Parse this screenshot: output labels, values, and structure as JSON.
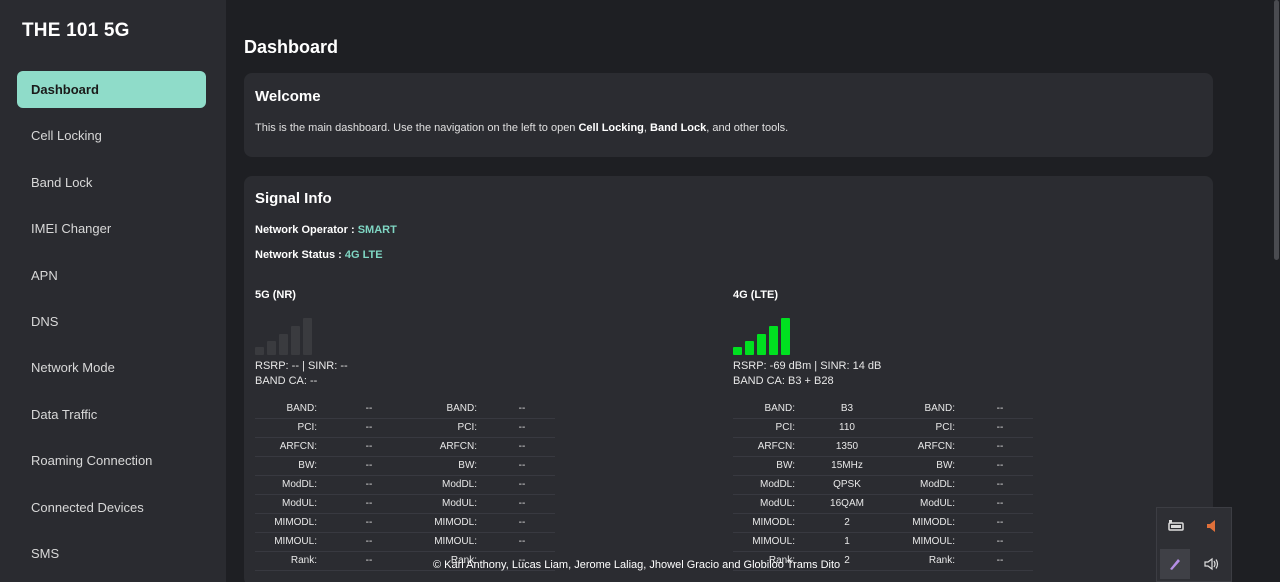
{
  "sidebar": {
    "brand": "THE 101 5G",
    "items": [
      {
        "label": "Dashboard",
        "active": true
      },
      {
        "label": "Cell Locking"
      },
      {
        "label": "Band Lock"
      },
      {
        "label": "IMEI Changer"
      },
      {
        "label": "APN"
      },
      {
        "label": "DNS"
      },
      {
        "label": "Network Mode"
      },
      {
        "label": "Data Traffic"
      },
      {
        "label": "Roaming Connection"
      },
      {
        "label": "Connected Devices"
      },
      {
        "label": "SMS"
      }
    ]
  },
  "main": {
    "title": "Dashboard",
    "welcome": {
      "title": "Welcome",
      "text_before": "This is the main dashboard. Use the navigation on the left to open ",
      "link1": "Cell Locking",
      "sep": ", ",
      "link2": "Band Lock",
      "text_after": ", and other tools."
    },
    "signal": {
      "title": "Signal Info",
      "operator_label": "Network Operator : ",
      "operator_value": "SMART",
      "status_label": "Network Status : ",
      "status_value": "4G LTE",
      "nr": {
        "label": "5G (NR)",
        "bars_active": 0,
        "rsrp_line": "RSRP: -- | SINR: --",
        "bandca_line": "BAND CA: --",
        "table_keys": [
          "BAND:",
          "PCI:",
          "ARFCN:",
          "BW:",
          "ModDL:",
          "ModUL:",
          "MIMODL:",
          "MIMOUL:",
          "Rank:"
        ],
        "col1": [
          "--",
          "--",
          "--",
          "--",
          "--",
          "--",
          "--",
          "--",
          "--"
        ],
        "col2": [
          "--",
          "--",
          "--",
          "--",
          "--",
          "--",
          "--",
          "--",
          "--"
        ]
      },
      "lte": {
        "label": "4G (LTE)",
        "bars_active": 5,
        "rsrp_line": "RSRP: -69 dBm | SINR: 14 dB",
        "bandca_line": "BAND CA: B3 + B28",
        "table_keys": [
          "BAND:",
          "PCI:",
          "ARFCN:",
          "BW:",
          "ModDL:",
          "ModUL:",
          "MIMODL:",
          "MIMOUL:",
          "Rank:"
        ],
        "col1": [
          "B3",
          "110",
          "1350",
          "15MHz",
          "QPSK",
          "16QAM",
          "2",
          "1",
          "2"
        ],
        "col2": [
          "--",
          "--",
          "--",
          "--",
          "--",
          "--",
          "--",
          "--",
          "--"
        ]
      }
    }
  },
  "footer": "© Karl Anthony, Lucas Liam, Jerome Laliag, Jhowel Gracio and Globiloo Trams Dito",
  "tray": {
    "icons": [
      "network-icon",
      "volume-mute-icon",
      "pen-icon",
      "speaker-icon"
    ]
  },
  "colors": {
    "accent": "#8fdcc9",
    "signal_active": "#00e020",
    "signal_inactive": "#3a3b3f",
    "value_teal": "#7fd6c3"
  }
}
